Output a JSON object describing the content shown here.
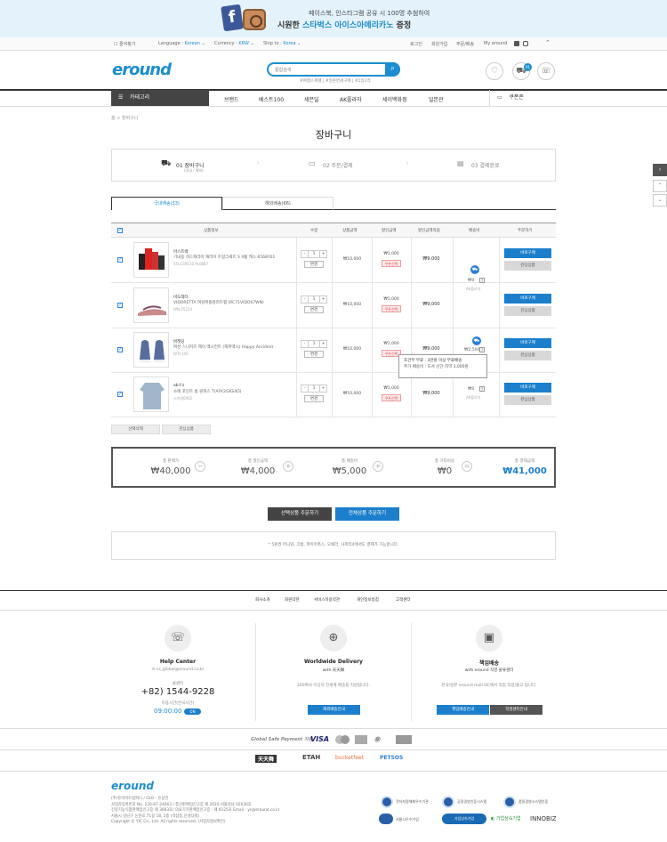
{
  "banner": {
    "line1": "페이스북, 인스타그램 공유 시 100명 추첨하여",
    "line2_a": "시원한 ",
    "line2_b": "스타벅스 아이스아메리카노",
    "line2_c": " 증정"
  },
  "util": {
    "bookmark": "즐겨찾기",
    "language_label": "Language :",
    "language_value": "Korean",
    "currency_label": "Currency :",
    "currency_value": "KRW",
    "ship_label": "Ship to :",
    "ship_value": "Korea",
    "login": "로그인",
    "join": "회원가입",
    "order": "주문/배송",
    "myeround": "My eround"
  },
  "header": {
    "logo": "eround",
    "search_placeholder": "통합검색",
    "tags": "#여행스캐쉘   |   #일본면세구매   |   #1일1역",
    "cart_count": "91"
  },
  "gnb": {
    "category": "카테고리",
    "menu": [
      "브랜드",
      "베스트100",
      "세븐딜",
      "AK플라자",
      "세이백화점",
      "일본관"
    ],
    "coupon": "쿠폰존"
  },
  "breadcrumb": "홈  >  장바구니",
  "page_title": "장바구니",
  "steps": [
    {
      "label": "01 장바구니",
      "sub": "(국내 / 해외)"
    },
    {
      "label": "02 주문/결제"
    },
    {
      "label": "03 결제완료"
    }
  ],
  "tabs": {
    "domestic": "국내배송(33)",
    "overseas": "해외배송(66)"
  },
  "table_headers": [
    "상품정보",
    "수량",
    "상품금액",
    "할인금액",
    "할인금액적용",
    "배송비",
    "주문하기"
  ],
  "items": [
    {
      "brand": "마스트랙",
      "name": "기내용 하드캐리어 캐리어 트렁크세트 S 4휠 케스 6568Y01",
      "code": "55LCSRE10 PL6887",
      "qty": "1",
      "price": "₩10,000",
      "discount": "₩1,000",
      "final": "₩9,000"
    },
    {
      "brand": "비도레타",
      "name": "VIDORETTA 여성퍼즐컬러트랩 (RC71VIDO07WN)",
      "code": "WN-55220",
      "qty": "1",
      "price": "₩10,000",
      "discount": "₩1,000",
      "final": "₩9,000"
    },
    {
      "brand": "버젯딩",
      "name": "여성 스니커즈 제이 액시언트 (해피액시) Happy Accident",
      "code": "WTI-140",
      "qty": "1",
      "price": "₩10,000",
      "discount": "₩1,000",
      "final": "₩9,000"
    },
    {
      "brand": "ab.f.z",
      "name": "소매 포인트 롱 원피스 T(AFK2GKS4O)",
      "code": "스마일6902",
      "qty": "1",
      "price": "₩10,000",
      "discount": "₩1,000",
      "final": "₩9,000"
    }
  ],
  "labels": {
    "change": "변경",
    "coupon": "쿠폰선택",
    "buy_now": "바로구매",
    "wish": "관심상품"
  },
  "shipping": {
    "fee1": "₩0",
    "fee1_note": "AK플라자",
    "fee2": "₩2,500",
    "fee3_note": "AK플라자"
  },
  "tooltip": {
    "line1": "조건부 무료 : 3만원 이상 무료배송",
    "line2": "추가 배송비 : 도서 산간 지역 3,000원"
  },
  "bulk": {
    "delete": "선택삭제",
    "wish": "관심상품"
  },
  "summary": [
    {
      "label": "총 판매가",
      "value": "₩40,000"
    },
    {
      "label": "총 할인금액",
      "value": "₩4,000"
    },
    {
      "label": "총 배송비",
      "value": "₩5,000"
    },
    {
      "label": "총 기타비용",
      "value": "₩0"
    },
    {
      "label": "총 결제금액",
      "value": "₩41,000"
    }
  ],
  "order_buttons": {
    "selected": "선택상품 주문하기",
    "all": "전체상품 주문하기"
  },
  "notice": "* 5원권 머니와, 크롬, 파이어폭스, 오페라, 사파리4에서도 결제가 가능합니다.",
  "footer_links": [
    "회사소개",
    "회원약관",
    "서비스이용약관",
    "개인정보방침",
    "고객센터"
  ],
  "help": {
    "title": "Help Center",
    "email": "cs_global@eround.co.kr",
    "phone_label": "콜센터",
    "phone": "+82) 1544-9228",
    "hours_label": "이용시간(한국시간)",
    "hours": "09:00:00",
    "on": "ON"
  },
  "worldwide": {
    "title": "Worldwide Delivery",
    "sub": "with 天天舞",
    "desc": "200여국 이상의 전세계 배송을 지원합니다.",
    "btn": "해외배송안내"
  },
  "domestic": {
    "title": "책임배송",
    "sub": "with eround 직영 물류센터",
    "desc": "한국/일본 eround mall DC에서 직접 작업/출고 됩니다.",
    "btn1": "책임배송안내",
    "btn2": "직영센터안내"
  },
  "payment": {
    "label": "Global Safe Payment 지원",
    "methods": [
      "VISA",
      "MC",
      "AMEX",
      "JCB",
      "UP"
    ]
  },
  "brands": [
    "天天舞",
    "ETAH",
    "bucketfeet",
    "PETSOS"
  ],
  "company": {
    "logo": "eround",
    "lines": [
      "(주)유라이트컴퍼니 / CEO : 유상민",
      "사업자등록번호 No. 120-87-24663 / 통신판매업신고증 제 2010-서울강남 02636호",
      "건강기능식품판매업신고증 제 3663호/ 의료기기판매업신고증 : 제 8125호 Email : yc@eround.co.kr",
      "서울시 강남구 논현로 71길 18, 2층 (역삼동,신성타워)",
      "Copyright © YIC Co., Ltd. All rights reserved. (사업자정보확인)"
    ]
  },
  "certs": [
    "전자지정해제우수기관",
    "공정경영인증시스템",
    "품질경영시스템인증",
    "서울시우수기업",
    "가업상속기업",
    "INNOBIZ"
  ]
}
